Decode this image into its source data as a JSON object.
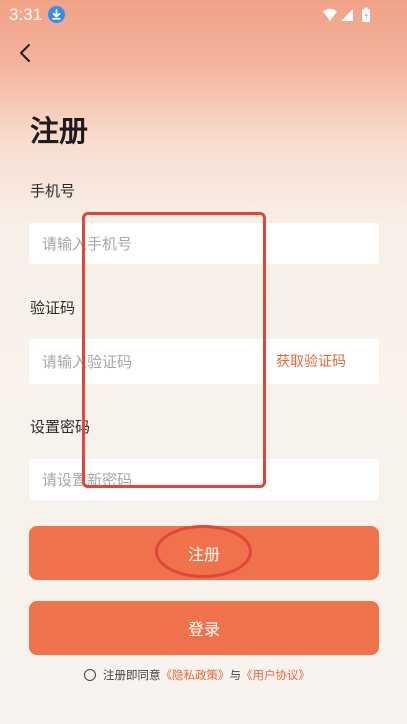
{
  "status_bar": {
    "time": "3:31",
    "icons": [
      "download-icon",
      "wifi-icon",
      "signal-icon",
      "battery-icon"
    ]
  },
  "nav": {
    "back_icon": "chevron-left-icon"
  },
  "page": {
    "title": "注册"
  },
  "form": {
    "phone": {
      "label": "手机号",
      "placeholder": "请输入手机号",
      "value": ""
    },
    "code": {
      "label": "验证码",
      "placeholder": "请输入验证码",
      "value": "",
      "get_code_label": "获取验证码"
    },
    "password": {
      "label": "设置密码",
      "placeholder": "请设置新密码",
      "value": ""
    }
  },
  "buttons": {
    "register_label": "注册",
    "login_label": "登录"
  },
  "agreement": {
    "checked": false,
    "prefix": "注册即同意",
    "privacy_link": "《隐私政策》",
    "connector": "与",
    "terms_link": "《用户协议》"
  },
  "colors": {
    "accent": "#ef724a",
    "link": "#e7683d",
    "annotation": "#e0463b",
    "header_gradient_top": "#f0a287",
    "background": "#f8f3ee"
  }
}
